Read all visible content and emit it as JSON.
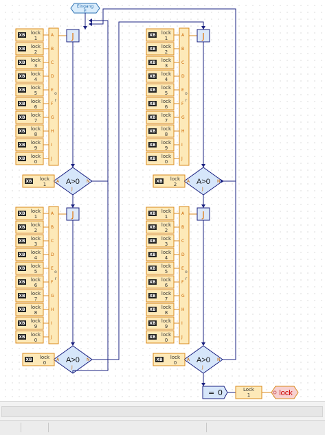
{
  "colors": {
    "blue": "#1f2a7a",
    "box_border": "#d98a1e",
    "box_fill": "#fde9b8",
    "diamond_fill": "#d6e6fa",
    "junction_fill": "#dce8f8",
    "output_fill": "#f7d0d0",
    "line": "#1a2080"
  },
  "entry": {
    "title": "Eingang",
    "sub": "E"
  },
  "input_rows": [
    {
      "top": "lock",
      "bottom": "1"
    },
    {
      "top": "lock",
      "bottom": "2"
    },
    {
      "top": "lock",
      "bottom": "3"
    },
    {
      "top": "lock",
      "bottom": "4"
    },
    {
      "top": "lock",
      "bottom": "5"
    },
    {
      "top": "lock",
      "bottom": "6"
    },
    {
      "top": "lock",
      "bottom": "7"
    },
    {
      "top": "lock",
      "bottom": "8"
    },
    {
      "top": "lock",
      "bottom": "9"
    },
    {
      "top": "lock",
      "bottom": "0"
    }
  ],
  "input_icon": "XB",
  "or_pins": [
    "A",
    "B",
    "C",
    "D",
    "E",
    "F",
    "G",
    "H",
    "I",
    "J"
  ],
  "or_label": "o r",
  "junction_label": "J",
  "condition_label": "A>0",
  "diamond_pins": {
    "left": "A",
    "right": "N",
    "bottom": "J"
  },
  "blocks": [
    {
      "id": "b1",
      "cond_input": {
        "top": "lock",
        "bottom": "1"
      }
    },
    {
      "id": "b2",
      "cond_input": {
        "top": "lock",
        "bottom": "2"
      }
    },
    {
      "id": "b3",
      "cond_input": {
        "top": "lock",
        "bottom": "0"
      }
    },
    {
      "id": "b4",
      "cond_input": {
        "top": "lock",
        "bottom": "0"
      }
    }
  ],
  "assign": {
    "label": "=",
    "value": "0"
  },
  "output_var": {
    "top": "Lock",
    "bottom": "1"
  },
  "output_terminal": {
    "label": "lock"
  }
}
